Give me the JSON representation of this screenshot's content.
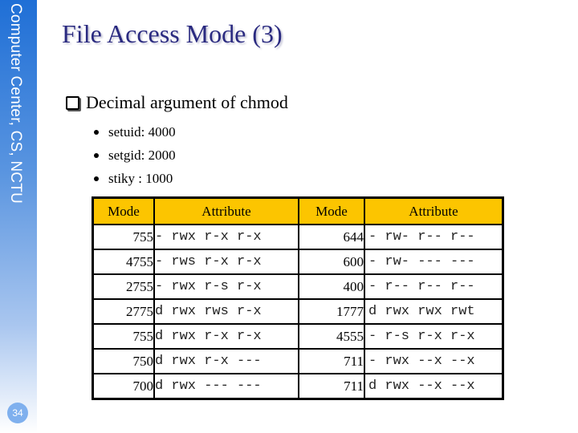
{
  "sidebar": {
    "label": "Computer Center, CS, NCTU",
    "page_number": "34"
  },
  "slide": {
    "title": "File Access Mode (3)",
    "main_bullet": "Decimal argument of chmod",
    "sub_bullets": [
      "setuid: 4000",
      "setgid: 2000",
      "stiky : 1000"
    ]
  },
  "table": {
    "headers": [
      "Mode",
      "Attribute",
      "Mode",
      "Attribute"
    ],
    "rows": [
      {
        "mode_left": "755",
        "attr_left": "- rwx r-x r-x",
        "mode_right": "644",
        "attr_right": "- rw- r-- r--"
      },
      {
        "mode_left": "4755",
        "attr_left": "- rws r-x r-x",
        "mode_right": "600",
        "attr_right": "- rw- --- ---"
      },
      {
        "mode_left": "2755",
        "attr_left": "- rwx r-s r-x",
        "mode_right": "400",
        "attr_right": "- r-- r-- r--"
      },
      {
        "mode_left": "2775",
        "attr_left": "d rwx rws r-x",
        "mode_right": "1777",
        "attr_right": "d rwx rwx rwt"
      },
      {
        "mode_left": "755",
        "attr_left": "d rwx r-x r-x",
        "mode_right": "4555",
        "attr_right": "- r-s r-x r-x"
      },
      {
        "mode_left": "750",
        "attr_left": "d rwx r-x ---",
        "mode_right": "711",
        "attr_right": "- rwx --x --x"
      },
      {
        "mode_left": "700",
        "attr_left": "d rwx --- ---",
        "mode_right": "711",
        "attr_right": "d rwx --x --x"
      }
    ]
  },
  "colors": {
    "sidebar_blue": "#1f6fd6",
    "title_color": "#2a2a80",
    "table_header": "#fcc500"
  }
}
